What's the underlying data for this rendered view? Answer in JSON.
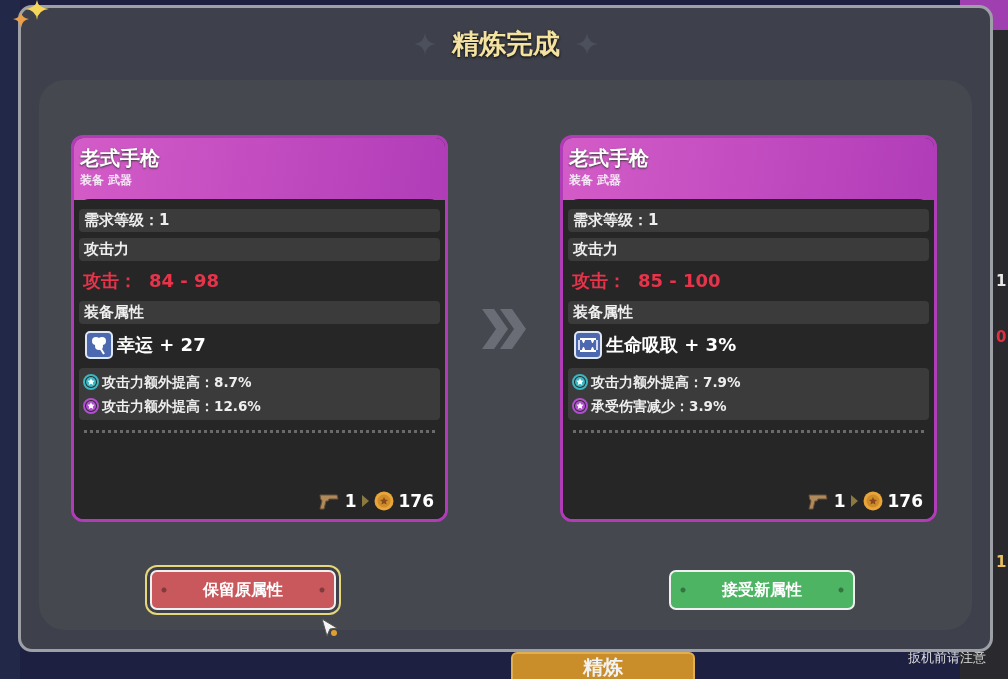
{
  "background": {
    "bottom_tab": "精炼",
    "right_fragments": [
      {
        "text": "1",
        "color": "#e8e8e8"
      },
      {
        "text": "0",
        "color": "#e03040"
      },
      {
        "text": "1",
        "color": "#e8c060"
      }
    ],
    "footer_note": "扳机前请注意"
  },
  "dialog": {
    "title": "精炼完成"
  },
  "cards": [
    {
      "name": "老式手枪",
      "type": "装备 武器",
      "level_req": "需求等级：1",
      "attack_header": "攻击力",
      "attack_label": "攻击：",
      "attack_value": "84 - 98",
      "attributes_header": "装备属性",
      "main_attribute": {
        "kind": "luck",
        "text": "幸运 + 27"
      },
      "sub_attributes": [
        {
          "text": "攻击力额外提高：8.7%",
          "color": "#3bb6c2"
        },
        {
          "text": "攻击力额外提高：12.6%",
          "color": "#b24fd0"
        }
      ],
      "footer": {
        "count": "1",
        "price": "176"
      }
    },
    {
      "name": "老式手枪",
      "type": "装备 武器",
      "level_req": "需求等级：1",
      "attack_header": "攻击力",
      "attack_label": "攻击：",
      "attack_value": "85 - 100",
      "attributes_header": "装备属性",
      "main_attribute": {
        "kind": "lifesteal",
        "text": "生命吸取 + 3%"
      },
      "sub_attributes": [
        {
          "text": "攻击力额外提高：7.9%",
          "color": "#3bb6c2"
        },
        {
          "text": "承受伤害减少：3.9%",
          "color": "#b24fd0"
        }
      ],
      "footer": {
        "count": "1",
        "price": "176"
      }
    }
  ],
  "buttons": [
    {
      "label": "保留原属性",
      "kind": "keep",
      "focused": true
    },
    {
      "label": "接受新属性",
      "kind": "accept",
      "focused": false
    }
  ]
}
